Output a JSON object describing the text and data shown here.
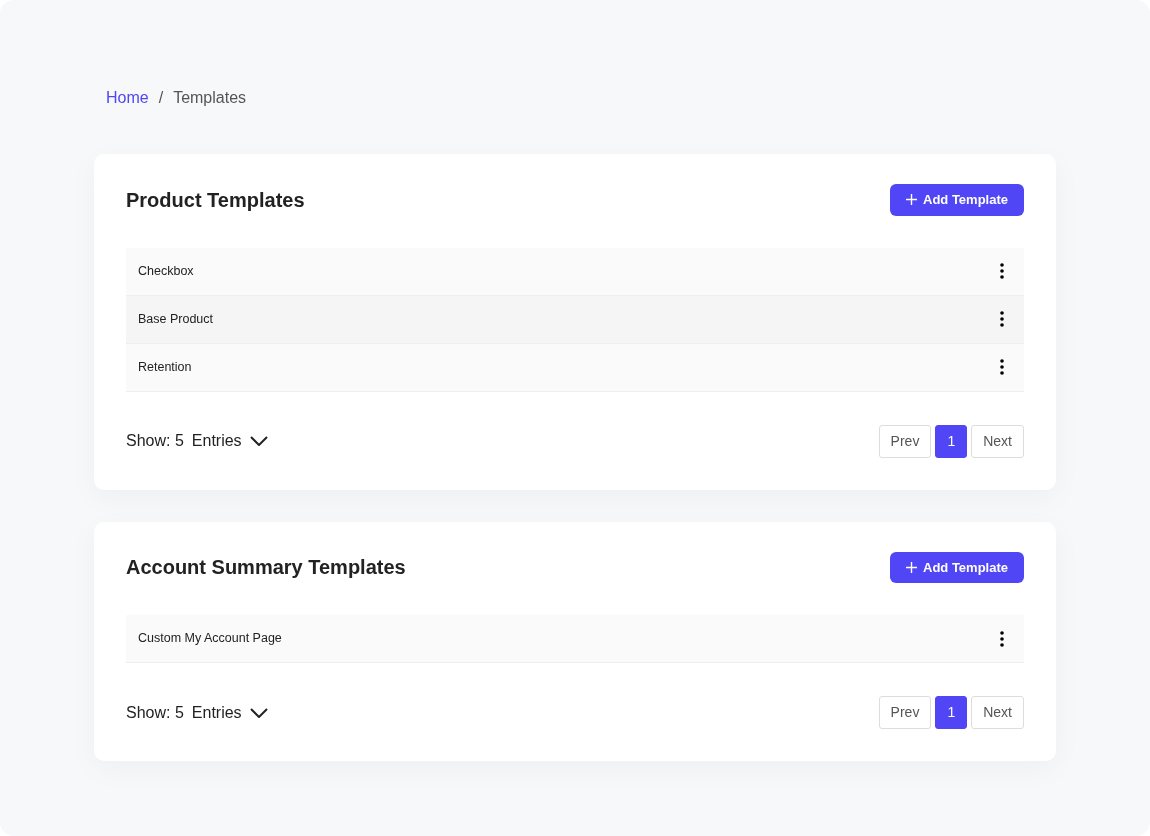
{
  "breadcrumb": [
    {
      "label": "Home",
      "selected": false
    },
    {
      "label": "Templates",
      "selected": true
    }
  ],
  "breadcrumb_separator": "/",
  "sections": [
    {
      "title": "Product Templates",
      "add_button": "Add Template",
      "rows": [
        {
          "name": "Checkbox"
        },
        {
          "name": "Base Product"
        },
        {
          "name": "Retention"
        }
      ],
      "show_label": "Show: 5",
      "entries_label": "Entries",
      "pagination": {
        "prev": "Prev",
        "pages": [
          {
            "label": "1",
            "selected": true
          }
        ],
        "next": "Next"
      }
    },
    {
      "title": "Account Summary Templates",
      "add_button": "Add Template",
      "rows": [
        {
          "name": "Custom My Account Page"
        }
      ],
      "show_label": "Show: 5",
      "entries_label": "Entries",
      "pagination": {
        "prev": "Prev",
        "pages": [
          {
            "label": "1",
            "selected": true
          }
        ],
        "next": "Next"
      }
    }
  ]
}
